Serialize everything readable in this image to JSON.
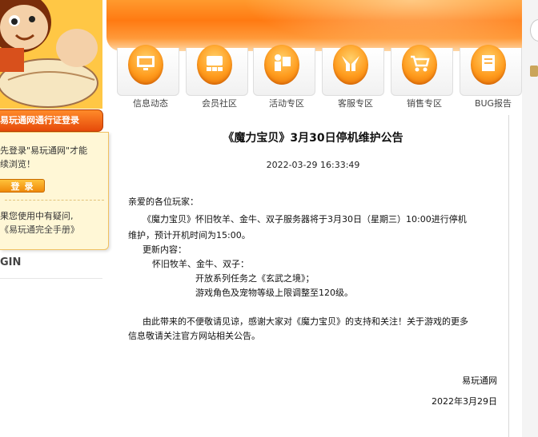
{
  "sidebar": {
    "login_tab": "易玩通网通行证登录",
    "login_msg_1": "先登录\"易玩通网\"才能",
    "login_msg_2": "续浏览！",
    "login_button": "登录",
    "help_1": "果您使用中有疑问,",
    "help_2": "《易玩通完全手册》",
    "gin": "GIN"
  },
  "nav": {
    "items": [
      {
        "label": "信息动态",
        "icon": "monitor-icon"
      },
      {
        "label": "会员社区",
        "icon": "community-icon"
      },
      {
        "label": "活动专区",
        "icon": "presenter-icon"
      },
      {
        "label": "客服专区",
        "icon": "hands-icon"
      },
      {
        "label": "销售专区",
        "icon": "cart-icon"
      },
      {
        "label": "BUG报告",
        "icon": "report-icon"
      }
    ]
  },
  "article": {
    "title": "《魔力宝贝》3月30日停机维护公告",
    "date": "2022-03-29 16:33:49",
    "greeting": "亲爱的各位玩家：",
    "para1_line1": "《魔力宝贝》怀旧牧羊、金牛、双子服务器将于3月30日（星期三）10:00进行停机",
    "para1_line2": "维护，预计开机时间为15:00。",
    "update_heading": "更新内容：",
    "servers": "怀旧牧羊、金牛、双子：",
    "update_1": "开放系列任务之《玄武之境》；",
    "update_2": "游戏角色及宠物等级上限调整至120级。",
    "closing_line1": "由此带来的不便敬请见谅，感谢大家对《魔力宝贝》的支持和关注！关于游戏的更多",
    "closing_line2": "信息敬请关注官方网站相关公告。",
    "sign_org": "易玩通网",
    "sign_date": "2022年3月29日"
  },
  "colors": {
    "accent_orange": "#ff7a12",
    "login_tab_red": "#e64a0a"
  }
}
